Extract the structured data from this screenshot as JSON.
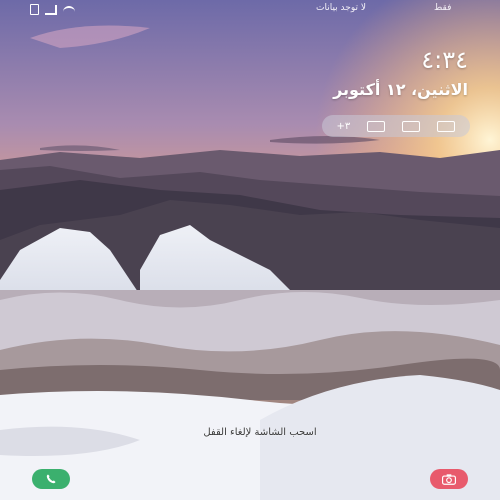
{
  "status_bar": {
    "carrier": "فقط",
    "no_sim": "لا توجد بيانات"
  },
  "lock": {
    "time": "٤:٣٤",
    "date": "الاثنين، ١٢ أكتوبر"
  },
  "notifications": {
    "count": "+٣",
    "icons": [
      "image-icon",
      "image-icon",
      "image-icon"
    ]
  },
  "hint": "اسحب الشاشة لإلغاء القفل",
  "shortcuts": {
    "left": "phone-icon",
    "right": "camera-icon"
  },
  "colors": {
    "phone": "#3bb06e",
    "camera": "#e85a6c"
  }
}
